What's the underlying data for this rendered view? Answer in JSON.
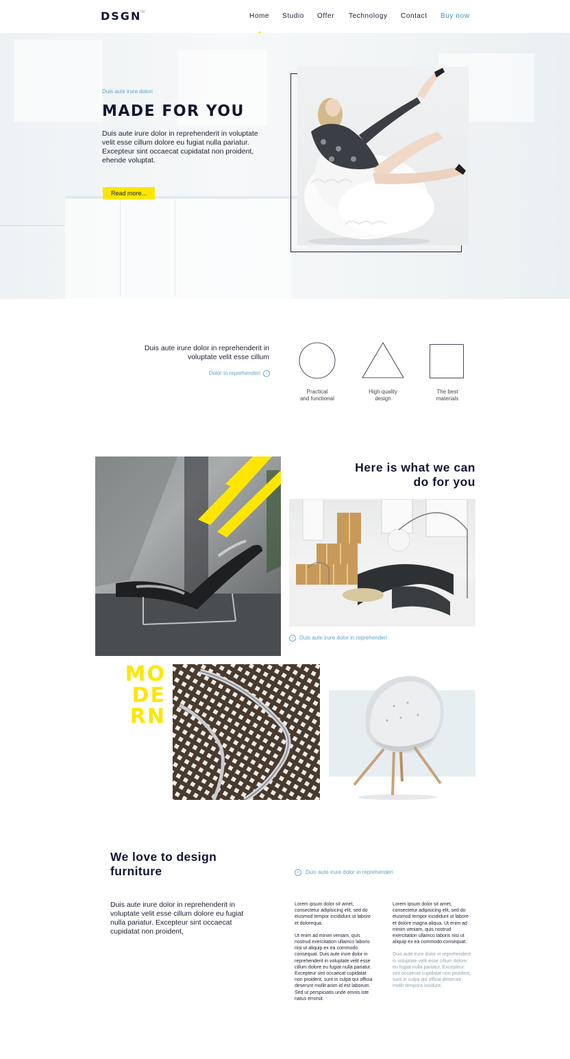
{
  "brand": {
    "logo": "DSGN",
    "tm": "TM"
  },
  "nav": {
    "items": [
      {
        "label": "Home"
      },
      {
        "label": "Studio"
      },
      {
        "label": "Offer"
      },
      {
        "label": "Technology"
      },
      {
        "label": "Contact"
      }
    ],
    "cta": "Buy now"
  },
  "hero": {
    "subtitle": "Duis aute irure dolori",
    "title": "MADE FOR YOU",
    "text": "Duis aute irure dolor in reprehenderit in voluptate velit esse cillum dolore eu fugiat nulla pariatur. Excepteur sint occaecat cupidatat non proident, ehende voluptat.",
    "button": "Read more..."
  },
  "features": {
    "text": "Duis aute irure dolor in reprehenderit in voluptate velit esse cillum",
    "link": "Dolor in reprehenderi",
    "items": [
      {
        "icon": "circle-icon",
        "label_line1": "Practical",
        "label_line2": "and functional"
      },
      {
        "icon": "triangle-icon",
        "label_line1": "High quality",
        "label_line2": "design"
      },
      {
        "icon": "square-icon",
        "label_line1": "The best",
        "label_line2": "materials"
      }
    ]
  },
  "gallery": {
    "title_line1": "Here is what we can",
    "title_line2": "do for you",
    "link": "Duis aute irure dolor in reprehenderi",
    "modern_rows": [
      "MO",
      "DE",
      "RN"
    ]
  },
  "about": {
    "title_line1": "We love to design",
    "title_line2": "furniture",
    "link": "Duis aute irure dolor in reprehenderi",
    "text": "Duis aute irure dolor in reprehenderit in voluptate velit esse cillum dolore eu fugiat nulla pariatur. Excepteur sint occaecat cupidatat non proident,",
    "col1": {
      "p1": "Lorem ipsum dolor sit amet, consectetur adipisicing elit, sed do eiusmod tempor incididunt ut labore et dolorequa.",
      "p2": "Ut enim ad minim veniam, quis nostrud exercitation ullamco laboris nisi ut aliquip ex ea commodo consequat. Duis aute irure dolor in reprehenderit in voluptate velit esse cillum dolore eu fugiat nulla pariatur. Excepteur sint occaecat cupidatat non proident, sunt in culpa qui officia deserunt mollit anim id est laborum. Sed ut perspiciatis unde omnis iste natus errorsit."
    },
    "col2": {
      "p1": "Lorem ipsum dolor sit amet, consectetur adipisicing elit, sed do eiusmod tempor incididunt ut labore et dolore magna aliqua. Ut enim ad minim veniam, quis nostrud exercitation ullamco laboris nisi ut aliquip ex ea commodo consequat.",
      "p2": "Duis aute irure dolor in reprehenderit in voluptate velit esse cillum dolore eu fugiat nulla pariatur. Excepteur sint occaecat cupidatat non proident, sunt in culpa qui officia deserunt mollit tempora incidunt."
    }
  },
  "colors": {
    "accent": "#ffe600",
    "link": "#5fa3c7",
    "text": "#1b1d33",
    "pale_blue": "#e6eef2"
  }
}
